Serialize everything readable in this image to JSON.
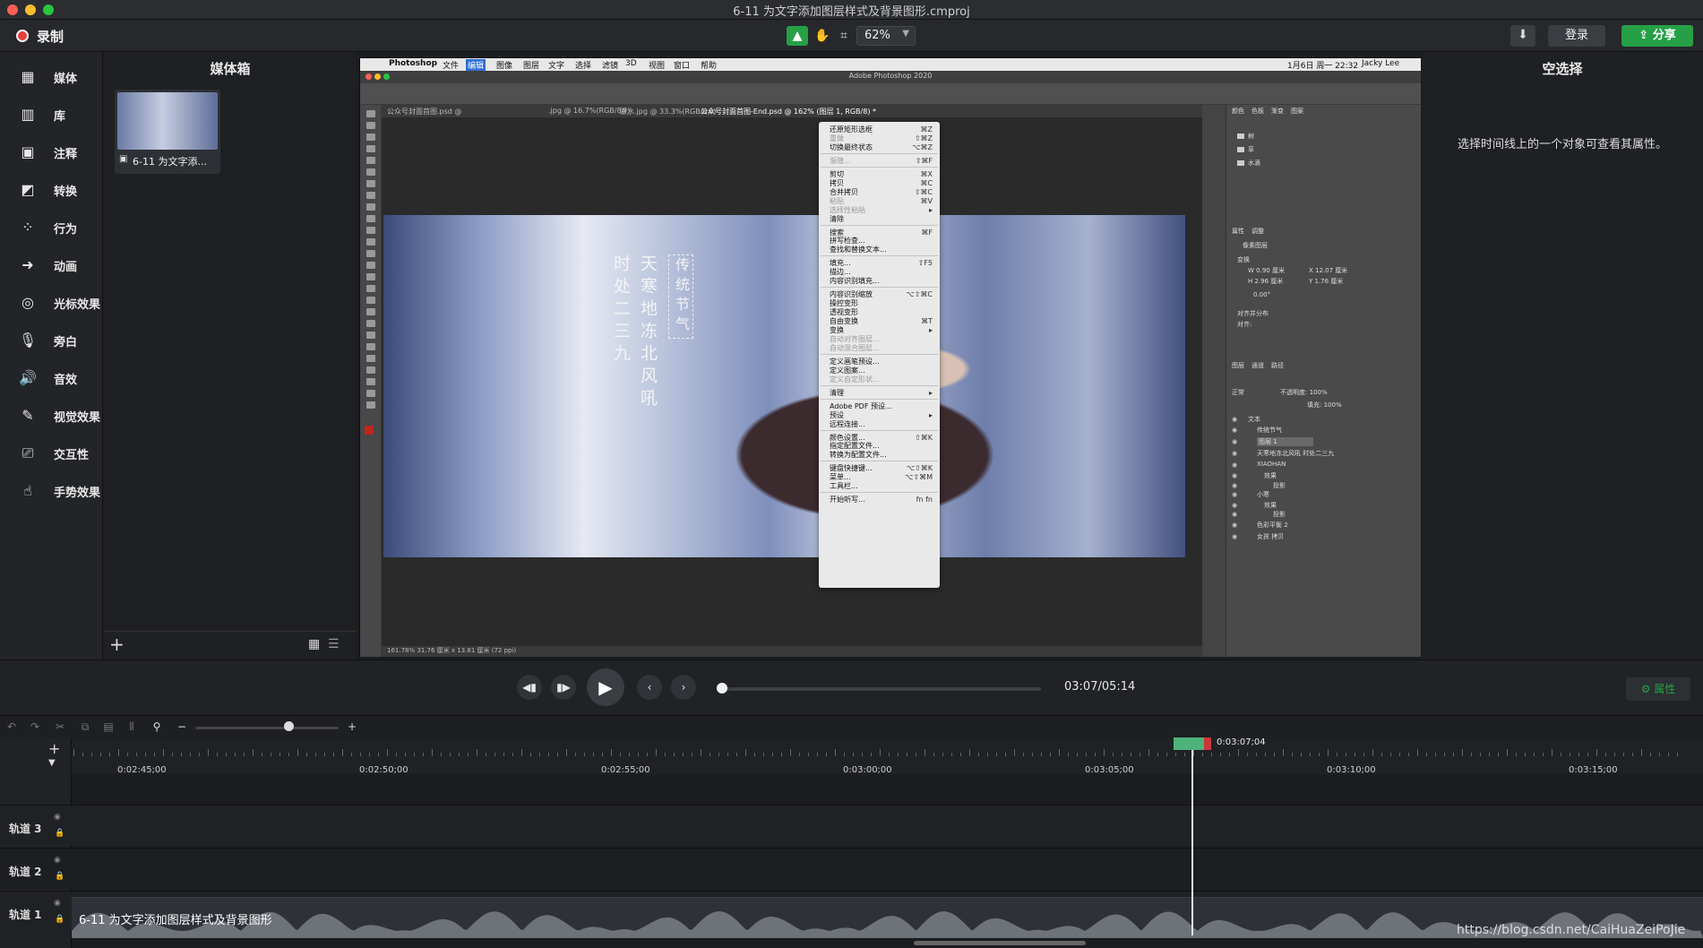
{
  "window": {
    "title": "6-11 为文字添加图层样式及背景图形.cmproj"
  },
  "toolbar": {
    "record_label": "录制",
    "zoom": "62%",
    "login": "登录",
    "share": "分享"
  },
  "sidebar": {
    "items": [
      {
        "label": "媒体",
        "icon": "media-icon"
      },
      {
        "label": "库",
        "icon": "library-icon"
      },
      {
        "label": "注释",
        "icon": "annotation-icon"
      },
      {
        "label": "转换",
        "icon": "transition-icon"
      },
      {
        "label": "行为",
        "icon": "behavior-icon"
      },
      {
        "label": "动画",
        "icon": "animation-icon"
      },
      {
        "label": "光标效果",
        "icon": "cursor-effect-icon"
      },
      {
        "label": "旁白",
        "icon": "microphone-icon"
      },
      {
        "label": "音效",
        "icon": "audio-icon"
      },
      {
        "label": "视觉效果",
        "icon": "visual-effect-icon"
      },
      {
        "label": "交互性",
        "icon": "interactivity-icon"
      },
      {
        "label": "手势效果",
        "icon": "gesture-icon"
      }
    ]
  },
  "mediabin": {
    "title": "媒体箱",
    "clip_label": "6-11 为文字添..."
  },
  "properties": {
    "title": "空选择",
    "description": "选择时间线上的一个对象可查看其属性。",
    "button": "属性"
  },
  "playback": {
    "time": "03:07/05:14",
    "progress": 0.0
  },
  "photoshop": {
    "app": "Photoshop",
    "menus": [
      "文件",
      "编辑",
      "图像",
      "图层",
      "文字",
      "选择",
      "滤镜",
      "3D",
      "视图",
      "窗口",
      "帮助"
    ],
    "window_title": "Adobe Photoshop 2020",
    "clock": "1月6日 周一 22:32",
    "user": "Jacky Lee",
    "tabs": [
      "公众号封面首图.psd @",
      ".jpg @ 16.7%(RGB/8#)",
      "跟水.jpg @ 33.3%(RGB/8#)",
      "公众号封面首图-End.psd @ 162% (图层 1, RGB/8) *"
    ],
    "status": "161.78%   31.76 厘米 x 13.81 厘米 (72 ppi)",
    "poem_col1": "天寒地冻北风吼",
    "poem_col2": "时处二三九",
    "poem_box": "传统节气",
    "right_panels": {
      "tabs1": [
        "颜色",
        "色板",
        "渐变",
        "图案"
      ],
      "folders": [
        "树",
        "草",
        "水滴"
      ],
      "tabs2": [
        "属性",
        "调整"
      ],
      "pixel_layer": "像素图层",
      "transform": "变换",
      "w": "W 0.90 厘米",
      "x": "X 12.07 厘米",
      "h": "H 2.96 厘米",
      "y": "Y 1.76 厘米",
      "angle": "0.00°",
      "align": "对齐并分布",
      "align_label": "对齐:",
      "tabs3": [
        "图层",
        "通道",
        "路径"
      ],
      "mode": "正常",
      "opacity": "不透明度: 100%",
      "fill": "填充: 100%",
      "layers": [
        "文本",
        "传统节气",
        "图层 1",
        "天寒地冻北风吼 时处二三九",
        "XIAOHAN",
        "效果",
        "投影",
        "小寒",
        "效果",
        "投影",
        "色彩平衡 2",
        "女孩 拷贝"
      ]
    },
    "edit_menu": [
      {
        "label": "还原矩形选框",
        "sc": "⌘Z"
      },
      {
        "label": "重做",
        "sc": "⇧⌘Z",
        "dis": true
      },
      {
        "label": "切换最终状态",
        "sc": "⌥⌘Z"
      },
      {
        "sep": true
      },
      {
        "label": "渐隐...",
        "sc": "⇧⌘F",
        "dis": true
      },
      {
        "sep": true
      },
      {
        "label": "剪切",
        "sc": "⌘X"
      },
      {
        "label": "拷贝",
        "sc": "⌘C"
      },
      {
        "label": "合并拷贝",
        "sc": "⇧⌘C"
      },
      {
        "label": "粘贴",
        "sc": "⌘V",
        "dis": true
      },
      {
        "label": "选择性粘贴",
        "sc": "▸",
        "dis": true
      },
      {
        "label": "清除",
        "sc": ""
      },
      {
        "sep": true
      },
      {
        "label": "搜索",
        "sc": "⌘F"
      },
      {
        "label": "拼写检查...",
        "sc": ""
      },
      {
        "label": "查找和替换文本...",
        "sc": ""
      },
      {
        "sep": true
      },
      {
        "label": "填充...",
        "sc": "⇧F5"
      },
      {
        "label": "描边...",
        "sc": ""
      },
      {
        "label": "内容识别填充...",
        "sc": ""
      },
      {
        "sep": true
      },
      {
        "label": "内容识别缩放",
        "sc": "⌥⇧⌘C"
      },
      {
        "label": "操控变形",
        "sc": ""
      },
      {
        "label": "透视变形",
        "sc": ""
      },
      {
        "label": "自由变换",
        "sc": "⌘T"
      },
      {
        "label": "变换",
        "sc": "▸"
      },
      {
        "label": "自动对齐图层...",
        "sc": "",
        "dis": true
      },
      {
        "label": "自动混合图层...",
        "sc": "",
        "dis": true
      },
      {
        "sep": true
      },
      {
        "label": "定义画笔预设...",
        "sc": ""
      },
      {
        "label": "定义图案...",
        "sc": ""
      },
      {
        "label": "定义自定形状...",
        "sc": "",
        "dis": true
      },
      {
        "sep": true
      },
      {
        "label": "清理",
        "sc": "▸"
      },
      {
        "sep": true
      },
      {
        "label": "Adobe PDF 预设...",
        "sc": ""
      },
      {
        "label": "预设",
        "sc": "▸"
      },
      {
        "label": "远程连接...",
        "sc": ""
      },
      {
        "sep": true
      },
      {
        "label": "颜色设置...",
        "sc": "⇧⌘K"
      },
      {
        "label": "指定配置文件...",
        "sc": ""
      },
      {
        "label": "转换为配置文件...",
        "sc": ""
      },
      {
        "sep": true
      },
      {
        "label": "键盘快捷键...",
        "sc": "⌥⇧⌘K"
      },
      {
        "label": "菜单...",
        "sc": "⌥⇧⌘M"
      },
      {
        "label": "工具栏...",
        "sc": ""
      },
      {
        "sep": true
      },
      {
        "label": "开始听写...",
        "sc": "fn fn"
      }
    ]
  },
  "timeline": {
    "playhead": "0:03:07;04",
    "ruler": [
      "0:02:45;00",
      "0:02:50;00",
      "0:02:55;00",
      "0:03:00;00",
      "0:03:05;00",
      "0:03:10;00",
      "0:03:15;00"
    ],
    "tracks": [
      "轨道 3",
      "轨道 2",
      "轨道 1"
    ],
    "clip_label": "6-11 为文字添加图层样式及背景图形"
  },
  "watermark": "https://blog.csdn.net/CaiHuaZeiPoJie"
}
